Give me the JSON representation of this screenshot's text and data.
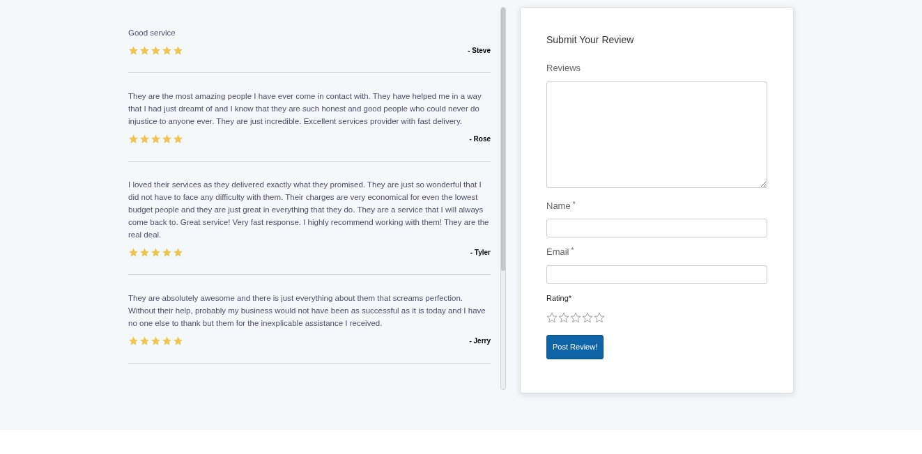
{
  "reviews": [
    {
      "text": "Good service",
      "stars": 5,
      "author": "- Steve"
    },
    {
      "text": "They are the most amazing people I have ever come in contact with. They have helped me in a way that I had just dreamt of and I know that they are such honest and good people who could never do injustice to anyone ever. They are just incredible. Excellent services provider with fast delivery.",
      "stars": 5,
      "author": "- Rose"
    },
    {
      "text": "I loved their services as they delivered exactly what they promised. They are just so wonderful that I did not have to face any difficulty with them. Their charges are very economical for even the lowest budget people and they are just great in everything that they do. They are a service that I will always come back to. Great service! Very fast response. I highly recommend working with them! They are the real deal.",
      "stars": 5,
      "author": "- Tyler"
    },
    {
      "text": "They are absolutely awesome and there is just everything about them that screams perfection. Without their help, probably my business would not have been as successful as it is today and I have no one else to thank but them for the inexplicable assistance I received.",
      "stars": 5,
      "author": "- Jerry"
    }
  ],
  "form": {
    "title": "Submit Your Review",
    "reviews_label": "Reviews",
    "name_label": "Name",
    "name_required": "*",
    "email_label": "Email",
    "email_required": "*",
    "rating_label": "Rating*",
    "rating": {
      "stars": 0
    },
    "submit": "Post Review!"
  }
}
